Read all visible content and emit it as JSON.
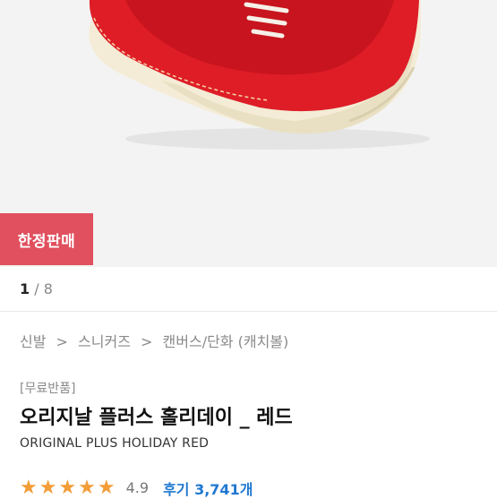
{
  "hero": {
    "badge_label": "한정판매"
  },
  "pager": {
    "current": "1",
    "separator": "/",
    "total": "8"
  },
  "breadcrumb": {
    "items": [
      "신발",
      "스니커즈",
      "캔버스/단화 (캐치볼)"
    ],
    "separator": ">"
  },
  "product": {
    "tag": "[무료반품]",
    "title": "오리지날 플러스 홀리데이 _ 레드",
    "subtitle": "ORIGINAL PLUS HOLIDAY RED",
    "rating": {
      "stars_display": "★★★★★",
      "stars_value": 4.9,
      "score": "4.9",
      "reviews_label": "후기 3,741개"
    }
  },
  "colors": {
    "accent_badge": "#e0505e",
    "shoe_red": "#de1d27",
    "star": "#f29d38",
    "review_link": "#1f78d1"
  },
  "icons": [
    "shoe-image",
    "star-icon"
  ]
}
